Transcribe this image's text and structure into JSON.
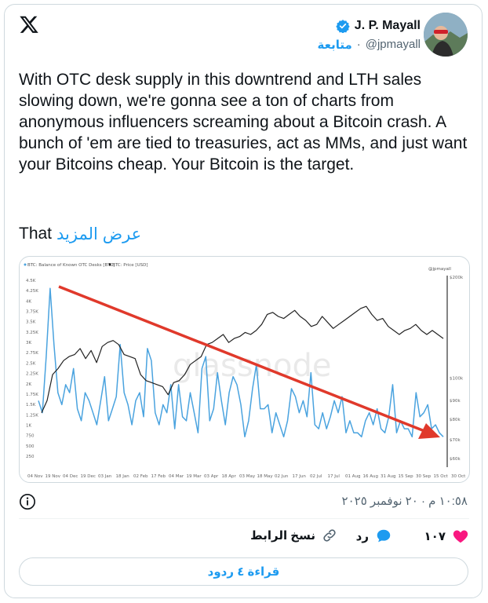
{
  "author": {
    "name": "J. P. Mayall",
    "handle": "@jpmayall",
    "follow_label": "متابعة"
  },
  "tweet": {
    "text": "With OTC desk supply in this downtrend and LTH sales slowing down, we're gonna see a ton of charts from anonymous influencers screaming about a Bitcoin crash. A bunch of 'em are tied to treasuries, act as MMs, and just want your Bitcoins cheap. Your Bitcoin is the target.",
    "last_word": "That",
    "show_more": "عرض المزيد"
  },
  "timestamp": "١٠:٥٨ م · ٢٠ نوفمبر ٢٠٢٥",
  "actions": {
    "likes": "١٠٧",
    "reply": "رد",
    "copy_link": "نسخ الرابط"
  },
  "read_replies": "قراءة ٤ ردود",
  "colors": {
    "accent": "#1d9bf0",
    "like": "#f91880",
    "otc_line": "#4aa3df",
    "price_line": "#222222",
    "arrow": "#e0392b"
  },
  "icons": [
    "x-logo-icon",
    "verified-badge-icon",
    "info-icon",
    "heart-icon",
    "reply-bubble-icon",
    "link-icon"
  ],
  "chart_data": {
    "type": "line",
    "legend": [
      "BTC: Balance of Known OTC Desks [BTC]",
      "BTC: Price [USD]"
    ],
    "watermark": "glassnode",
    "source_tag": "@jpmayall",
    "left_axis_ticks": [
      "4.5K",
      "4.25K",
      "4K",
      "3.75K",
      "3.5K",
      "3.25K",
      "3K",
      "2.75K",
      "2.5K",
      "2.25K",
      "2K",
      "1.75K",
      "1.5K",
      "1.25K",
      "1K",
      "750",
      "500",
      "250"
    ],
    "right_axis_ticks": [
      "$200k",
      "$100k",
      "$90k",
      "$80k",
      "$70k",
      "$60k"
    ],
    "x_ticks": [
      "04 Nov",
      "19 Nov",
      "04 Dec",
      "19 Dec",
      "03 Jan",
      "18 Jan",
      "02 Feb",
      "17 Feb",
      "04 Mar",
      "19 Mar",
      "03 Apr",
      "18 Apr",
      "03 May",
      "18 May",
      "02 Jun",
      "17 Jun",
      "02 Jul",
      "17 Jul",
      "01 Aug",
      "16 Aug",
      "31 Aug",
      "15 Sep",
      "30 Sep",
      "15 Oct",
      "30 Oct"
    ],
    "series": [
      {
        "name": "BTC: Balance of Known OTC Desks [BTC]",
        "values": [
          1500,
          1200,
          2600,
          4300,
          2900,
          1700,
          1400,
          1900,
          1700,
          2300,
          1300,
          1000,
          1700,
          1500,
          1200,
          900,
          1500,
          2100,
          1000,
          1300,
          1600,
          2900,
          1700,
          1400,
          900,
          1500,
          1700,
          1100,
          2800,
          2500,
          1200,
          900,
          1400,
          1200,
          1900,
          800,
          1900,
          1100,
          1000,
          1700,
          1200,
          700,
          2300,
          2600,
          1000,
          1300,
          2200,
          1500,
          900,
          1700,
          2100,
          1900,
          1400,
          600,
          1000,
          1800,
          2400,
          1300,
          1300,
          1400,
          700,
          1200,
          900,
          600,
          1000,
          1800,
          1600,
          1200,
          1500,
          1100,
          2200,
          900,
          800,
          1200,
          800,
          1100,
          1500,
          1200,
          1600,
          700,
          1000,
          700,
          700,
          600,
          1000,
          1200,
          900,
          1300,
          800,
          700,
          1100,
          1900,
          700,
          1000,
          800,
          800,
          600,
          1700,
          1100,
          1200,
          1400,
          800,
          900,
          700,
          600
        ]
      },
      {
        "name": "BTC: Price [USD]",
        "values": [
          69000,
          75000,
          88000,
          91000,
          95000,
          97000,
          98000,
          101000,
          96000,
          100000,
          94000,
          102000,
          104000,
          105000,
          103000,
          98000,
          97000,
          96000,
          88000,
          85000,
          84000,
          83000,
          82000,
          78000,
          84000,
          85000,
          88000,
          93000,
          95000,
          97000,
          103000,
          104000,
          106000,
          108000,
          104000,
          106000,
          107000,
          109000,
          108000,
          110000,
          113000,
          118000,
          119000,
          117000,
          116000,
          118000,
          120000,
          117000,
          115000,
          112000,
          113000,
          117000,
          114000,
          111000,
          113000,
          115000,
          117000,
          119000,
          121000,
          122000,
          118000,
          115000,
          116000,
          112000,
          110000,
          108000,
          110000,
          111000,
          113000,
          110000,
          108000,
          110000,
          108000,
          106000
        ]
      }
    ]
  }
}
